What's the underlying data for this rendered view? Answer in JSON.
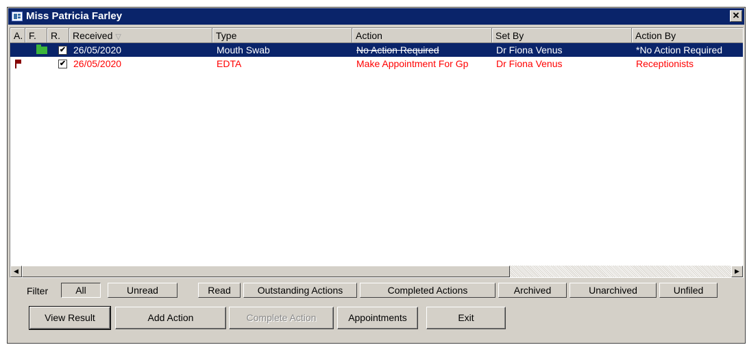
{
  "window": {
    "title": "Miss Patricia Farley",
    "close_label": "✕"
  },
  "columns": [
    {
      "label": "A."
    },
    {
      "label": "F."
    },
    {
      "label": "R."
    },
    {
      "label": "Received",
      "sort": "▽"
    },
    {
      "label": "Type"
    },
    {
      "label": "Action"
    },
    {
      "label": "Set By"
    },
    {
      "label": "Action By"
    }
  ],
  "rows": [
    {
      "flag": "",
      "filed_icon": "folder-icon",
      "read": "✔",
      "received": "26/05/2020",
      "type": "Mouth Swab",
      "action": "No Action Required",
      "set_by": "Dr Fiona Venus",
      "action_by": "*No Action Required",
      "selected": true
    },
    {
      "flag": "flag-icon",
      "filed_icon": "",
      "read": "✔",
      "received": "26/05/2020",
      "type": "EDTA",
      "action": "Make Appointment For Gp",
      "set_by": "Dr Fiona Venus",
      "action_by": "Receptionists",
      "color": "#ff0000"
    }
  ],
  "scrollbar": {
    "left_arrow": "◀",
    "right_arrow": "▶"
  },
  "filter": {
    "label": "Filter",
    "selected": "All",
    "options": [
      "All",
      "Unread",
      "Read",
      "Outstanding Actions",
      "Completed Actions",
      "Archived",
      "Unarchived",
      "Unfiled"
    ]
  },
  "actions": {
    "view_result": "View Result",
    "add_action": "Add Action",
    "complete_action": "Complete Action",
    "appointments": "Appointments",
    "exit": "Exit"
  },
  "colors": {
    "titlebar": "#0a246a",
    "selection": "#0a246a",
    "alert_text": "#ff0000",
    "filed_folder": "#3bb53b",
    "flag": "#8b0000"
  }
}
